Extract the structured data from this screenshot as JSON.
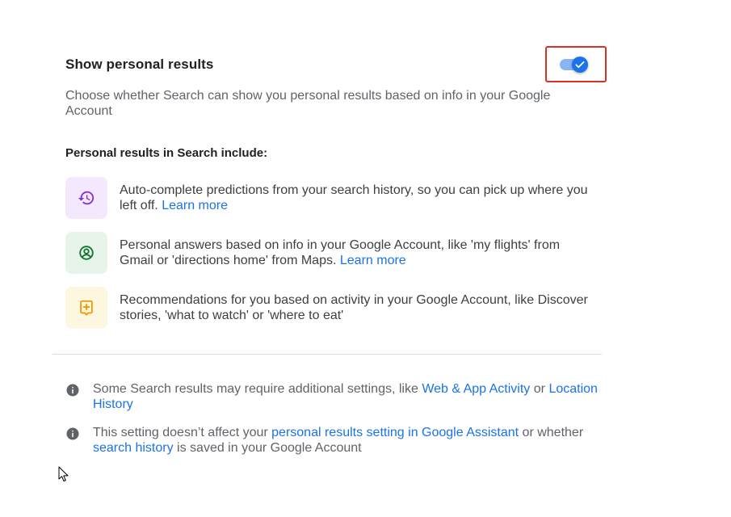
{
  "header": {
    "title": "Show personal results",
    "toggle_state": "on",
    "description": "Choose whether Search can show you personal results based on info in your Google Account"
  },
  "section": {
    "heading": "Personal results in Search include:",
    "items": [
      {
        "icon": "history-icon",
        "icon_bg": "#f3e8fd",
        "icon_color": "#8430ce",
        "text": "Auto-complete predictions from your search history, so you can pick up where you left off.",
        "link": "Learn more"
      },
      {
        "icon": "account-circle-icon",
        "icon_bg": "#e6f4ea",
        "icon_color": "#137333",
        "text": "Personal answers based on info in your Google Account, like 'my flights' from Gmail or 'directions home' from Maps.",
        "link": "Learn more"
      },
      {
        "icon": "add-recommendation-icon",
        "icon_bg": "#fef7e0",
        "icon_color": "#f29900",
        "text": "Recommendations for you based on activity in your Google Account, like Discover stories, 'what to watch' or 'where to eat'",
        "link": ""
      }
    ]
  },
  "notes": [
    {
      "icon": "info-icon",
      "before": "Some Search results may require additional settings, like ",
      "link1": "Web & App Activity",
      "middle": " or ",
      "link2": "Location History",
      "after": ""
    },
    {
      "icon": "info-icon",
      "before": "This setting doesn’t affect your ",
      "link1": "personal results setting in Google Assistant",
      "middle": " or whether ",
      "link2": "search history",
      "after": " is saved in your Google Account"
    }
  ],
  "colors": {
    "accent": "#1a73e8",
    "highlight": "#d93025"
  }
}
